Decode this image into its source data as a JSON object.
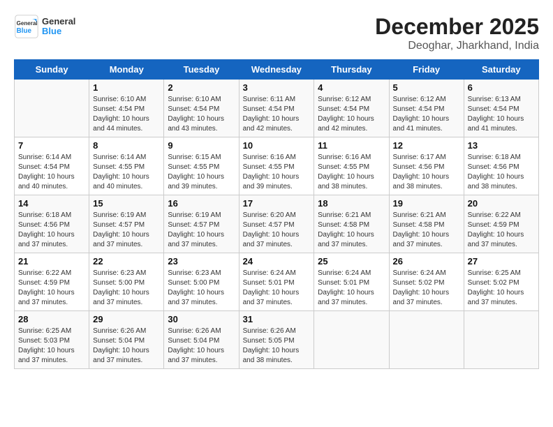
{
  "header": {
    "logo_general": "General",
    "logo_blue": "Blue",
    "month_title": "December 2025",
    "location": "Deoghar, Jharkhand, India"
  },
  "days_of_week": [
    "Sunday",
    "Monday",
    "Tuesday",
    "Wednesday",
    "Thursday",
    "Friday",
    "Saturday"
  ],
  "weeks": [
    [
      {
        "day": "",
        "info": ""
      },
      {
        "day": "1",
        "info": "Sunrise: 6:10 AM\nSunset: 4:54 PM\nDaylight: 10 hours\nand 44 minutes."
      },
      {
        "day": "2",
        "info": "Sunrise: 6:10 AM\nSunset: 4:54 PM\nDaylight: 10 hours\nand 43 minutes."
      },
      {
        "day": "3",
        "info": "Sunrise: 6:11 AM\nSunset: 4:54 PM\nDaylight: 10 hours\nand 42 minutes."
      },
      {
        "day": "4",
        "info": "Sunrise: 6:12 AM\nSunset: 4:54 PM\nDaylight: 10 hours\nand 42 minutes."
      },
      {
        "day": "5",
        "info": "Sunrise: 6:12 AM\nSunset: 4:54 PM\nDaylight: 10 hours\nand 41 minutes."
      },
      {
        "day": "6",
        "info": "Sunrise: 6:13 AM\nSunset: 4:54 PM\nDaylight: 10 hours\nand 41 minutes."
      }
    ],
    [
      {
        "day": "7",
        "info": "Sunrise: 6:14 AM\nSunset: 4:54 PM\nDaylight: 10 hours\nand 40 minutes."
      },
      {
        "day": "8",
        "info": "Sunrise: 6:14 AM\nSunset: 4:55 PM\nDaylight: 10 hours\nand 40 minutes."
      },
      {
        "day": "9",
        "info": "Sunrise: 6:15 AM\nSunset: 4:55 PM\nDaylight: 10 hours\nand 39 minutes."
      },
      {
        "day": "10",
        "info": "Sunrise: 6:16 AM\nSunset: 4:55 PM\nDaylight: 10 hours\nand 39 minutes."
      },
      {
        "day": "11",
        "info": "Sunrise: 6:16 AM\nSunset: 4:55 PM\nDaylight: 10 hours\nand 38 minutes."
      },
      {
        "day": "12",
        "info": "Sunrise: 6:17 AM\nSunset: 4:56 PM\nDaylight: 10 hours\nand 38 minutes."
      },
      {
        "day": "13",
        "info": "Sunrise: 6:18 AM\nSunset: 4:56 PM\nDaylight: 10 hours\nand 38 minutes."
      }
    ],
    [
      {
        "day": "14",
        "info": "Sunrise: 6:18 AM\nSunset: 4:56 PM\nDaylight: 10 hours\nand 37 minutes."
      },
      {
        "day": "15",
        "info": "Sunrise: 6:19 AM\nSunset: 4:57 PM\nDaylight: 10 hours\nand 37 minutes."
      },
      {
        "day": "16",
        "info": "Sunrise: 6:19 AM\nSunset: 4:57 PM\nDaylight: 10 hours\nand 37 minutes."
      },
      {
        "day": "17",
        "info": "Sunrise: 6:20 AM\nSunset: 4:57 PM\nDaylight: 10 hours\nand 37 minutes."
      },
      {
        "day": "18",
        "info": "Sunrise: 6:21 AM\nSunset: 4:58 PM\nDaylight: 10 hours\nand 37 minutes."
      },
      {
        "day": "19",
        "info": "Sunrise: 6:21 AM\nSunset: 4:58 PM\nDaylight: 10 hours\nand 37 minutes."
      },
      {
        "day": "20",
        "info": "Sunrise: 6:22 AM\nSunset: 4:59 PM\nDaylight: 10 hours\nand 37 minutes."
      }
    ],
    [
      {
        "day": "21",
        "info": "Sunrise: 6:22 AM\nSunset: 4:59 PM\nDaylight: 10 hours\nand 37 minutes."
      },
      {
        "day": "22",
        "info": "Sunrise: 6:23 AM\nSunset: 5:00 PM\nDaylight: 10 hours\nand 37 minutes."
      },
      {
        "day": "23",
        "info": "Sunrise: 6:23 AM\nSunset: 5:00 PM\nDaylight: 10 hours\nand 37 minutes."
      },
      {
        "day": "24",
        "info": "Sunrise: 6:24 AM\nSunset: 5:01 PM\nDaylight: 10 hours\nand 37 minutes."
      },
      {
        "day": "25",
        "info": "Sunrise: 6:24 AM\nSunset: 5:01 PM\nDaylight: 10 hours\nand 37 minutes."
      },
      {
        "day": "26",
        "info": "Sunrise: 6:24 AM\nSunset: 5:02 PM\nDaylight: 10 hours\nand 37 minutes."
      },
      {
        "day": "27",
        "info": "Sunrise: 6:25 AM\nSunset: 5:02 PM\nDaylight: 10 hours\nand 37 minutes."
      }
    ],
    [
      {
        "day": "28",
        "info": "Sunrise: 6:25 AM\nSunset: 5:03 PM\nDaylight: 10 hours\nand 37 minutes."
      },
      {
        "day": "29",
        "info": "Sunrise: 6:26 AM\nSunset: 5:04 PM\nDaylight: 10 hours\nand 37 minutes."
      },
      {
        "day": "30",
        "info": "Sunrise: 6:26 AM\nSunset: 5:04 PM\nDaylight: 10 hours\nand 37 minutes."
      },
      {
        "day": "31",
        "info": "Sunrise: 6:26 AM\nSunset: 5:05 PM\nDaylight: 10 hours\nand 38 minutes."
      },
      {
        "day": "",
        "info": ""
      },
      {
        "day": "",
        "info": ""
      },
      {
        "day": "",
        "info": ""
      }
    ]
  ]
}
